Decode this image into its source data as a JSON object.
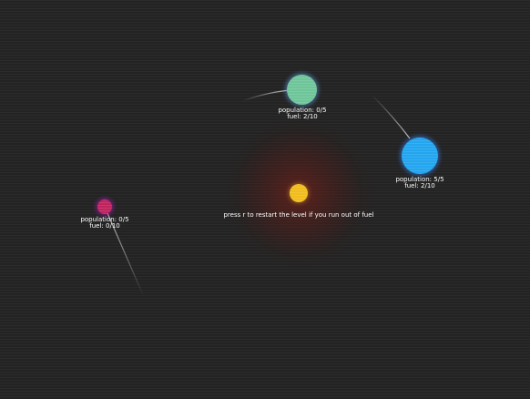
{
  "colors": {
    "background": "#232323",
    "sun": "#f1bd1e",
    "sun_glow": "#8c1e14",
    "planet_green": "#6fc59a",
    "planet_blue": "#23a6ef",
    "planet_pink": "#c0245f",
    "text": "#ffffff"
  },
  "hint": "press r to restart the level if you run out of fuel",
  "planets": {
    "green": {
      "population": "population: 0/5",
      "fuel": "fuel: 2/10"
    },
    "blue": {
      "population": "population: 5/5",
      "fuel": "fuel: 2/10"
    },
    "pink": {
      "population": "population: 0/5",
      "fuel": "fuel: 0/10"
    }
  }
}
